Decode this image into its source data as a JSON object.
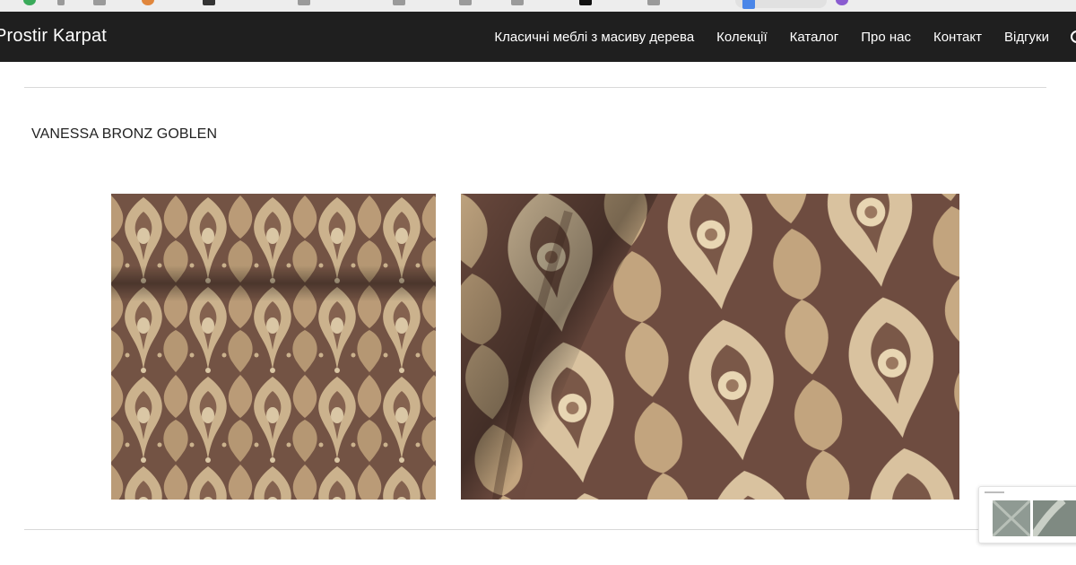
{
  "nav": {
    "brand": "Prostir Karpat",
    "items": [
      {
        "label": "Класичні меблі з масиву дерева"
      },
      {
        "label": "Колекції"
      },
      {
        "label": "Каталог"
      },
      {
        "label": "Про нас"
      },
      {
        "label": "Контакт"
      },
      {
        "label": "Відгуки"
      }
    ]
  },
  "product": {
    "title": "VANESSA BRONZ GOBLEN"
  },
  "colors": {
    "nav_bg": "#1f1f1f",
    "fabric_base": "#7c5a4a",
    "pattern_gold": "#d8c09a"
  }
}
